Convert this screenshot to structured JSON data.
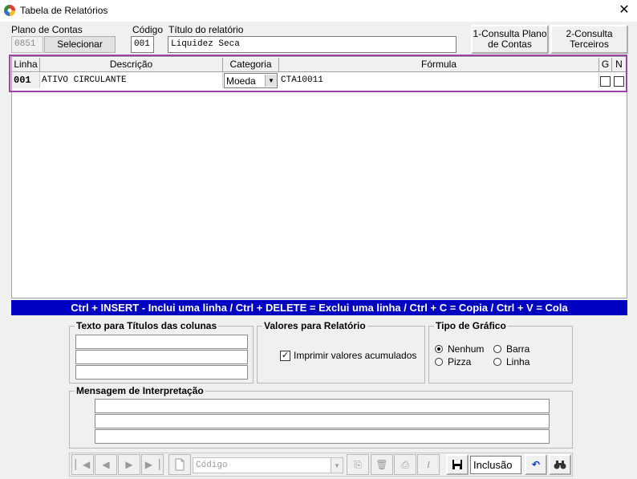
{
  "window": {
    "title": "Tabela de Relatórios",
    "close_glyph": "✕"
  },
  "header": {
    "plano_label": "Plano de Contas",
    "plano_value": "0851",
    "selecionar_label": "Selecionar",
    "codigo_label": "Código",
    "codigo_value": "001",
    "titulo_label": "Título do relatório",
    "titulo_value": "Liquidez Seca",
    "consulta_plano_l1": "1-Consulta Plano",
    "consulta_plano_l2": "de Contas",
    "consulta_terceiros_l1": "2-Consulta",
    "consulta_terceiros_l2": "Terceiros"
  },
  "grid": {
    "columns": [
      "Linha",
      "Descrição",
      "Categoria",
      "Fórmula",
      "G",
      "N"
    ],
    "rows": [
      {
        "linha": "001",
        "descricao": "ATIVO CIRCULANTE",
        "categoria": "Moeda",
        "formula": "CTA10011",
        "g": false,
        "n": false
      }
    ]
  },
  "hint": "Ctrl + INSERT - Inclui uma linha  /  Ctrl + DELETE = Exclui uma linha / Ctrl + C = Copia / Ctrl + V = Cola",
  "groups": {
    "textos_title": "Texto para Títulos das colunas",
    "valores_title": "Valores para Relatório",
    "imprimir_label": "Imprimir valores acumulados",
    "imprimir_checked": true,
    "grafico_title": "Tipo de Gráfico",
    "grafico_options": [
      "Nenhum",
      "Barra",
      "Pizza",
      "Linha"
    ],
    "grafico_selected": "Nenhum",
    "mensagem_title": "Mensagem de Interpretação"
  },
  "navbar": {
    "search_placeholder": "Código",
    "mode_label": "Inclusão"
  },
  "colors": {
    "accent_blue": "#0000c0",
    "highlight_purple": "#a040a8"
  }
}
